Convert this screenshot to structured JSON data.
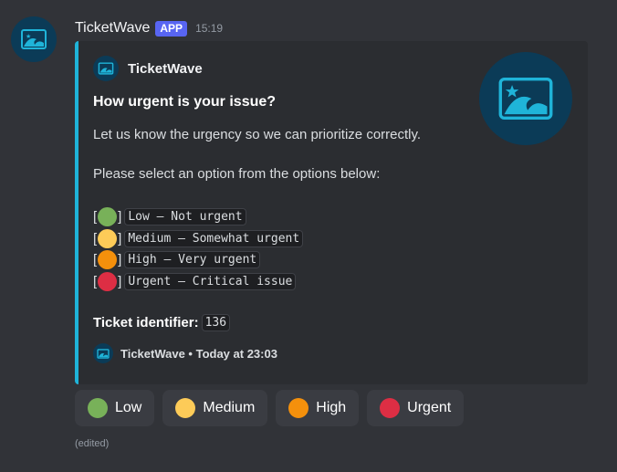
{
  "colors": {
    "accent_bar": "#1fb4d9",
    "app_badge": "#5865f2",
    "low": "#78b159",
    "medium": "#fdcb58",
    "high": "#f4900c",
    "urgent": "#dd2e44",
    "logo_bg": "#0b3b57",
    "logo_fg": "#1fb4d9"
  },
  "header": {
    "username": "TicketWave",
    "badge": "APP",
    "timestamp": "15:19"
  },
  "embed": {
    "author": "TicketWave",
    "title": "How urgent is your issue?",
    "description": "Let us know the urgency so we can prioritize correctly.",
    "instruction": "Please select an option from the options below:",
    "options": [
      {
        "bracket_open": "[",
        "bracket_close": "]",
        "label": "Low — Not urgent",
        "color": "low"
      },
      {
        "bracket_open": "[",
        "bracket_close": "]",
        "label": "Medium — Somewhat urgent",
        "color": "medium"
      },
      {
        "bracket_open": "[",
        "bracket_close": "]",
        "label": "High — Very urgent",
        "color": "high"
      },
      {
        "bracket_open": "[",
        "bracket_close": "]",
        "label": "Urgent — Critical issue",
        "color": "urgent"
      }
    ],
    "ticket_label": "Ticket identifier:",
    "ticket_value": "136",
    "footer": "TicketWave • Today at 23:03",
    "thumbnail_icon": "ticket-wave-logo-icon"
  },
  "buttons": [
    {
      "label": "Low",
      "color": "low"
    },
    {
      "label": "Medium",
      "color": "medium"
    },
    {
      "label": "High",
      "color": "high"
    },
    {
      "label": "Urgent",
      "color": "urgent"
    }
  ],
  "edited_label": "(edited)"
}
